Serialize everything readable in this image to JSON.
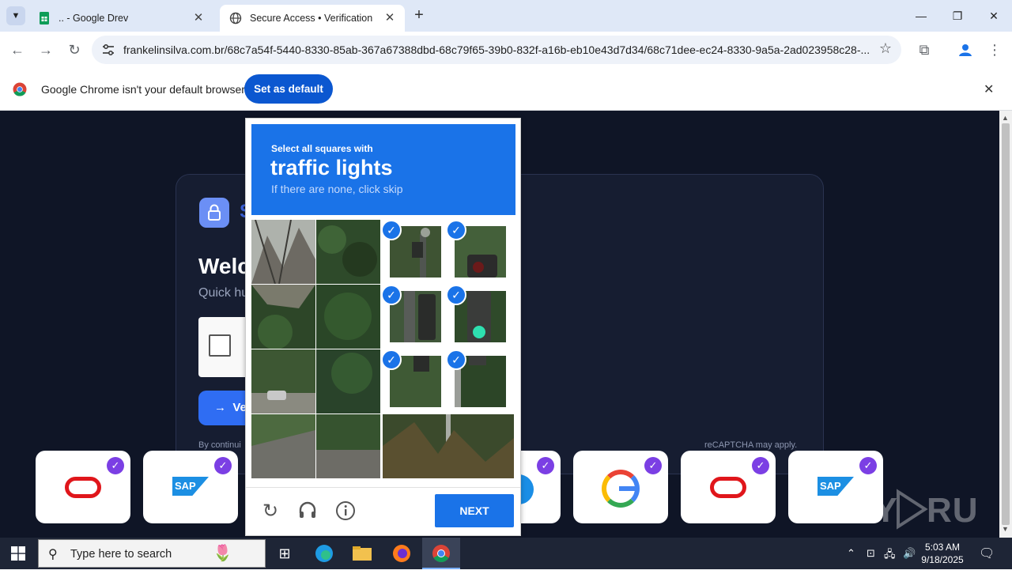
{
  "browser": {
    "tabs": [
      {
        "title": ".. - Google Drev",
        "active": false
      },
      {
        "title": "Secure Access • Verification",
        "active": true
      }
    ],
    "url": "frankelinsilva.com.br/68c7a54f-5440-8330-85ab-367a67388dbd-68c79f65-39b0-832f-a16b-eb10e43d7d34/68c71dee-ec24-8330-9a5a-2ad023958c28-...",
    "infobar": {
      "message": "Google Chrome isn't your default browser",
      "button": "Set as default"
    }
  },
  "page": {
    "brand_initial": "S",
    "welcome_partial": "Welc",
    "quick_partial": "Quick hu",
    "verify_partial": "Ve",
    "fine_left": "By continui",
    "fine_right": "reCAPTCHA may apply.",
    "watermark": "ANY RUN",
    "tiles": [
      {
        "logo": "oracle"
      },
      {
        "logo": "sap",
        "text": "SAP"
      },
      {
        "logo": "microsoft"
      },
      {
        "logo": "google"
      },
      {
        "logo": "oracle"
      },
      {
        "logo": "sap",
        "text": "SAP"
      }
    ]
  },
  "captcha": {
    "instruction": "Select all squares with",
    "target": "traffic lights",
    "hint": "If there are none, click skip",
    "next_label": "NEXT",
    "selected_cells": [
      2,
      3,
      6,
      7,
      10,
      11
    ]
  },
  "taskbar": {
    "search_placeholder": "Type here to search",
    "time": "5:03 AM",
    "date": "9/18/2025"
  },
  "colors": {
    "accent": "#1a73e8",
    "chrome_button": "#0b57d0",
    "page_bg": "#0f1526",
    "tile_check": "#7b3fe4"
  }
}
